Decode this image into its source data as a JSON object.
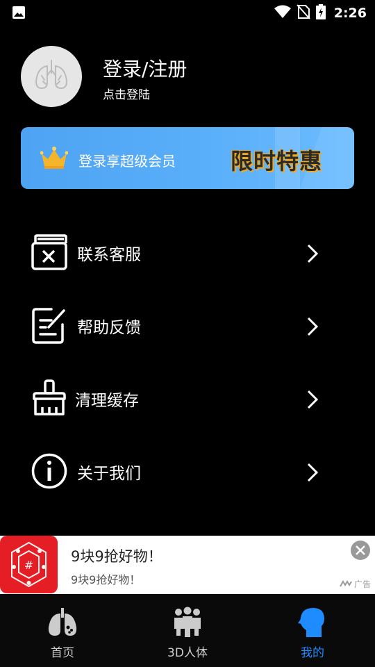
{
  "status_bar": {
    "time": "2:26",
    "icons": [
      "image-icon",
      "wifi-icon",
      "no-sim-icon",
      "battery-charging-icon"
    ]
  },
  "profile": {
    "title": "登录/注册",
    "subtitle": "点击登陆",
    "avatar_icon": "lungs-icon"
  },
  "vip_banner": {
    "text": "登录享超级会员",
    "promo": "限时特惠",
    "icon": "crown-icon"
  },
  "menu": {
    "items": [
      {
        "label": "联系客服",
        "icon": "contact-service-icon"
      },
      {
        "label": "帮助反馈",
        "icon": "feedback-icon"
      },
      {
        "label": "清理缓存",
        "icon": "brush-icon"
      },
      {
        "label": "关于我们",
        "icon": "info-icon"
      }
    ]
  },
  "ad": {
    "title": "9块9抢好物！",
    "subtitle": "9块9抢好物！",
    "tag": "广告"
  },
  "tabbar": {
    "tabs": [
      {
        "label": "首页",
        "icon": "lungs-tab-icon",
        "active": false
      },
      {
        "label": "3D人体",
        "icon": "people-icon",
        "active": false
      },
      {
        "label": "我的",
        "icon": "head-profile-icon",
        "active": true
      }
    ]
  },
  "colors": {
    "background": "#000000",
    "accent": "#1e8bff",
    "banner": "#5bb0fa",
    "promo_gold": "#f2a81d",
    "ad_red": "#e51e25"
  }
}
